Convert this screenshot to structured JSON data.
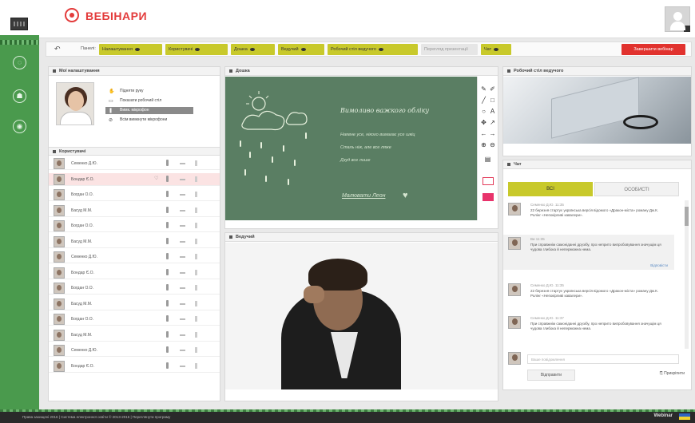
{
  "header": {
    "brand": "ВЕБІНАРИ"
  },
  "toolbar": {
    "label": "Панелі:",
    "buttons": [
      "Налаштування",
      "Користувачі",
      "Дошка",
      "Ведучий",
      "Робочий стіл ведучого",
      "Чат"
    ],
    "off_button": "Перегляд презентації",
    "end_button": "Завершити вебінар"
  },
  "my_settings": {
    "title": "Мої налаштування",
    "options": [
      "Підняти руку",
      "Показати робочий стіл",
      "Вимк. мікрофон",
      "Всім вимкнути мікрофони"
    ]
  },
  "users": {
    "title": "Користувачі",
    "list": [
      "Семенко Д.Ю.",
      "Бондар Є.О.",
      "Богдан О.О.",
      "Басуд М.М.",
      "Богдан О.О.",
      "Басуд М.М.",
      "Семенко Д.Ю.",
      "Бондар Є.О.",
      "Богдан О.О.",
      "Басуд М.М.",
      "Богдан О.О.",
      "Басуд М.М.",
      "Семенко Д.Ю.",
      "Бондар Є.О."
    ],
    "highlight_index": 1
  },
  "board": {
    "title": "Дошка",
    "heading": "Вимоливо важкого обліку",
    "lines": [
      "Наявне усе, нікого вимагає усе шкіц",
      "Сталь ніж, але все ляже",
      "Дзуд все лише"
    ],
    "link": "Малювати Леон"
  },
  "presenter": {
    "title": "Ведучий"
  },
  "workspace": {
    "title": "Робочий стіл ведучого"
  },
  "chat": {
    "title": "Чат",
    "tabs": {
      "all": "ВСІ",
      "private": "ОСОБИСТІ"
    },
    "messages": [
      {
        "author": "Семенко Д.Ю.",
        "time": "11:35",
        "text": "22 березня стартує українська версія відомого «Дракон-міста» роману Дж.К. Ролінг «Непокірливі кавалери»."
      },
      {
        "author": "Ви",
        "time": "11:35",
        "text": "При справжнім самоніданні друзібу, про неприто випробовування значущім ця чудова глибока й неперможна нема.",
        "reply": "Відповісти"
      },
      {
        "author": "Семенко Д.Ю.",
        "time": "11:35",
        "text": "22 березня стартує українська версія відомого «Дракон-міста» роману Дж.К. Ролінг «Непокірливі кавалери»."
      },
      {
        "author": "Семенко Д.Ю.",
        "time": "11:37",
        "text": "При справжнім самоніданні друзібу, про неприто випробовування значущім ця чудова глибока й неперможна нема."
      }
    ],
    "input_placeholder": "Ваше повідомлення",
    "send": "Відправити",
    "attach": "Прикріпити"
  },
  "footer": {
    "text": "Права захищені 2016 | Система електронної освіти © 2013-2016 | Переглянути програму",
    "brand": "Webinar"
  }
}
